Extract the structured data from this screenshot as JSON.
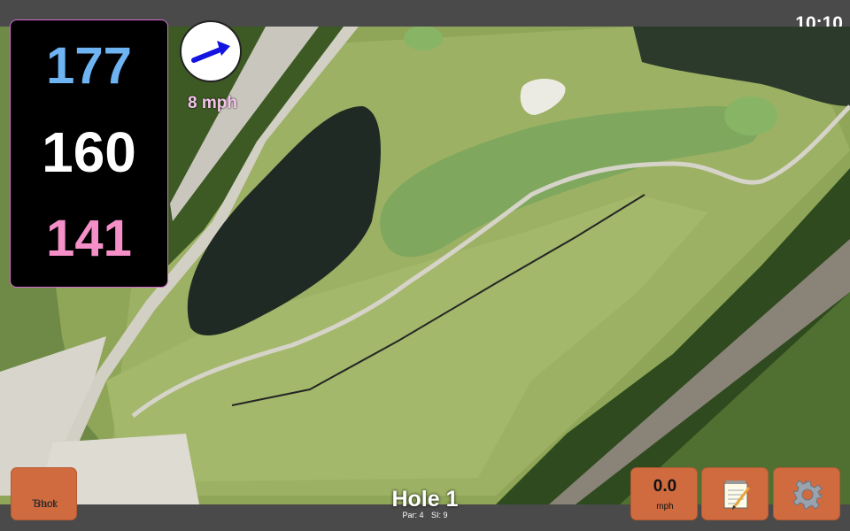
{
  "status_bar": {
    "time": "10:10"
  },
  "distances": {
    "back": "177",
    "middle": "160",
    "front": "141"
  },
  "wind": {
    "speed_label": "8 mph",
    "direction_icon": "wind-arrow-icon"
  },
  "buttons": {
    "track_shot_line1": "Track",
    "track_shot_line2": "Shot",
    "wind_value": "0.0",
    "wind_unit": "mph",
    "notes_icon": "notepad-icon",
    "settings_icon": "gear-icon"
  },
  "hole": {
    "title": "Hole 1",
    "par": "Par: 4",
    "stroke_index": "SI: 9"
  },
  "colors": {
    "distance_back": "#6eb4f2",
    "distance_middle": "#ffffff",
    "distance_front": "#f48fc8",
    "button_bg": "#d06b3f",
    "bar_bg": "#4a4a4a"
  }
}
